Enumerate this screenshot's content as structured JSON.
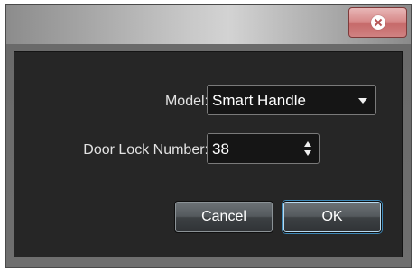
{
  "dialog": {
    "close_icon": "close-icon",
    "model_label": "Model:",
    "model_value": "Smart Handle",
    "door_lock_label": "Door Lock Number:",
    "door_lock_value": "38",
    "cancel_label": "Cancel",
    "ok_label": "OK"
  },
  "colors": {
    "panel": "#262626",
    "close_button": "#d88b8b",
    "text": "#e2e2e2"
  }
}
